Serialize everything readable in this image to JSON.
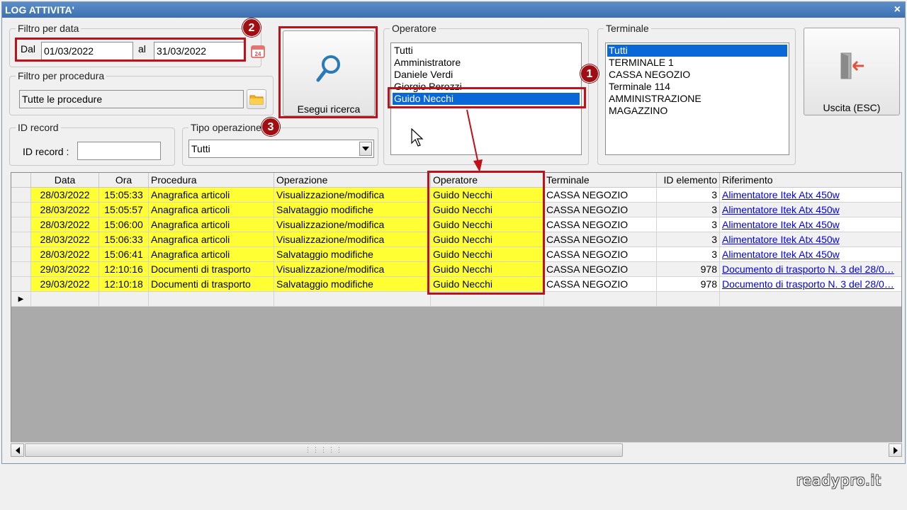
{
  "window": {
    "title": "LOG ATTIVITA'",
    "close_glyph": "×"
  },
  "date_filter": {
    "legend": "Filtro per data",
    "from_label": "Dal",
    "from_value": "01/03/2022",
    "to_label": "al",
    "to_value": "31/03/2022",
    "calendar_icon": "calendar-icon",
    "calendar_text": "24"
  },
  "procedure_filter": {
    "legend": "Filtro per procedura",
    "value": "Tutte le procedure",
    "folder_icon": "folder-icon"
  },
  "search_button": {
    "label": "Esegui ricerca",
    "icon": "search-icon"
  },
  "id_record": {
    "legend": "ID record",
    "label": "ID record :",
    "value": ""
  },
  "op_type": {
    "legend": "Tipo operazione",
    "value": "Tutti"
  },
  "operator": {
    "legend": "Operatore",
    "items": [
      "Tutti",
      "Amministratore",
      "Daniele Verdi",
      "Giorgio Perozzi",
      "Guido Necchi"
    ],
    "selected_index": 4
  },
  "terminal": {
    "legend": "Terminale",
    "items": [
      "Tutti",
      "TERMINALE 1",
      "CASSA NEGOZIO",
      "Terminale 114",
      "AMMINISTRAZIONE",
      "MAGAZZINO"
    ],
    "selected_index": 0
  },
  "exit_button": {
    "label": "Uscita (ESC)",
    "icon": "exit-door-icon"
  },
  "badges": [
    "1",
    "2",
    "3"
  ],
  "grid": {
    "columns": [
      "Data",
      "Ora",
      "Procedura",
      "Operazione",
      "Operatore",
      "Terminale",
      "ID elemento",
      "Riferimento"
    ],
    "rows": [
      [
        "28/03/2022",
        "15:05:33",
        "Anagrafica articoli",
        "Visualizzazione/modifica",
        "Guido Necchi",
        "CASSA NEGOZIO",
        "3",
        "Alimentatore Itek Atx 450w"
      ],
      [
        "28/03/2022",
        "15:05:57",
        "Anagrafica articoli",
        "Salvataggio modifiche",
        "Guido Necchi",
        "CASSA NEGOZIO",
        "3",
        "Alimentatore Itek Atx 450w"
      ],
      [
        "28/03/2022",
        "15:06:00",
        "Anagrafica articoli",
        "Visualizzazione/modifica",
        "Guido Necchi",
        "CASSA NEGOZIO",
        "3",
        "Alimentatore Itek Atx 450w"
      ],
      [
        "28/03/2022",
        "15:06:33",
        "Anagrafica articoli",
        "Visualizzazione/modifica",
        "Guido Necchi",
        "CASSA NEGOZIO",
        "3",
        "Alimentatore Itek Atx 450w"
      ],
      [
        "28/03/2022",
        "15:06:41",
        "Anagrafica articoli",
        "Salvataggio modifiche",
        "Guido Necchi",
        "CASSA NEGOZIO",
        "3",
        "Alimentatore Itek Atx 450w"
      ],
      [
        "29/03/2022",
        "12:10:16",
        "Documenti di trasporto",
        "Visualizzazione/modifica",
        "Guido Necchi",
        "CASSA NEGOZIO",
        "978",
        "Documento di trasporto N. 3 del 28/0…"
      ],
      [
        "29/03/2022",
        "12:10:18",
        "Documenti di trasporto",
        "Salvataggio modifiche",
        "Guido Necchi",
        "CASSA NEGOZIO",
        "978",
        "Documento di trasporto N. 3 del 28/0…"
      ]
    ],
    "highlight_color": "#ffff33",
    "new_row_marker": "▶"
  },
  "colors": {
    "title_bar": "#3d70b0",
    "selection": "#0a67d8",
    "annotation_red": "#c0111a",
    "link": "#0000ee"
  },
  "watermark": "readypro.it"
}
